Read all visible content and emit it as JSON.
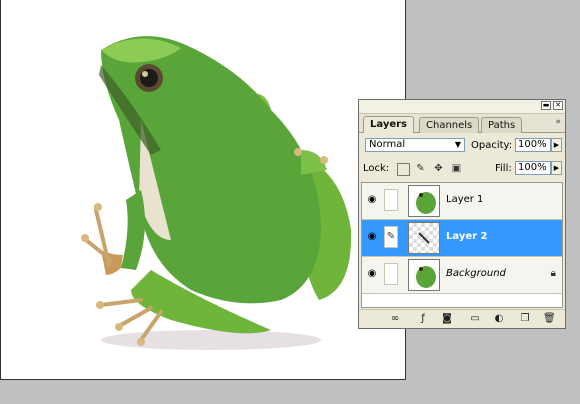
{
  "palette": {
    "tabs": [
      "Layers",
      "Channels",
      "Paths"
    ],
    "blend_mode": "Normal",
    "opacity_label": "Opacity:",
    "opacity_value": "100%",
    "lock_label": "Lock:",
    "fill_label": "Fill:",
    "fill_value": "100%",
    "layers": [
      {
        "name": "Layer 1",
        "visible": true,
        "selected": false
      },
      {
        "name": "Layer 2",
        "visible": true,
        "selected": true
      },
      {
        "name": "Background",
        "visible": true,
        "selected": false,
        "locked": true
      }
    ],
    "bottom_icons": [
      "link-layers-icon",
      "layer-style-icon",
      "layer-mask-icon",
      "new-group-icon",
      "adjustment-layer-icon",
      "new-layer-icon",
      "trash-icon"
    ]
  },
  "colors": {
    "selection": "#3399ff",
    "palette_bg": "#ece9d8",
    "workspace": "#c0c0c0"
  }
}
